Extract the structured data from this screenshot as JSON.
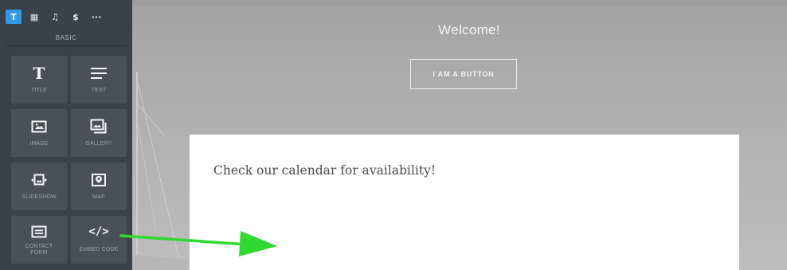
{
  "sidebar": {
    "category_tabs": [
      {
        "glyph": "T",
        "name": "basic",
        "active": true
      },
      {
        "glyph": "▦",
        "name": "layout",
        "active": false
      },
      {
        "glyph": "♫",
        "name": "media",
        "active": false
      },
      {
        "glyph": "$",
        "name": "commerce",
        "active": false
      },
      {
        "glyph": "···",
        "name": "more",
        "active": false
      }
    ],
    "section_label": "BASIC",
    "tiles": [
      {
        "label": "TITLE",
        "icon": "title-icon"
      },
      {
        "label": "TEXT",
        "icon": "text-icon"
      },
      {
        "label": "IMAGE",
        "icon": "image-icon"
      },
      {
        "label": "GALLERY",
        "icon": "gallery-icon"
      },
      {
        "label": "SLIDESHOW",
        "icon": "slideshow-icon"
      },
      {
        "label": "MAP",
        "icon": "map-icon"
      },
      {
        "label": "CONTACT FORM",
        "icon": "contact-form-icon"
      },
      {
        "label": "EMBED CODE",
        "icon": "embed-code-icon"
      }
    ]
  },
  "canvas": {
    "welcome": "Welcome!",
    "button_label": "I AM A BUTTON",
    "content_text": "Check our calendar for availability!"
  },
  "colors": {
    "sidebar_bg": "#3c4147",
    "tile_bg": "#4b5057",
    "active_tab": "#2f9be6",
    "arrow": "#2fd92f"
  }
}
